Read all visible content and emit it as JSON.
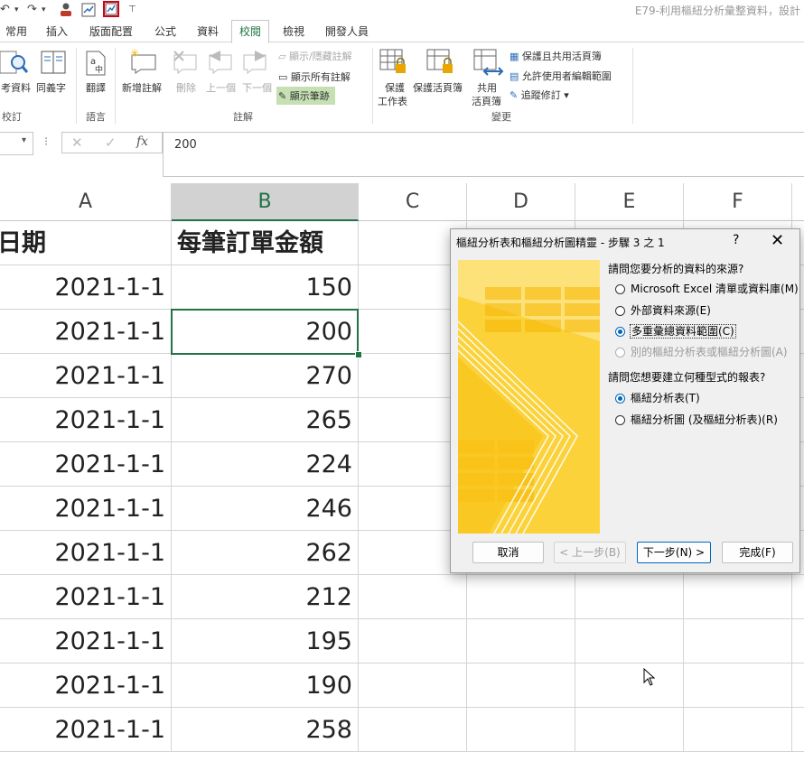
{
  "window": {
    "title": "E79-利用樞紐分析彙整資料，設計"
  },
  "qat": {
    "undo": "↶",
    "redo": "↷",
    "dd1": "▾",
    "dd2": "▾",
    "customize": "⊤"
  },
  "tabs": [
    "常用",
    "插入",
    "版面配置",
    "公式",
    "資料",
    "校閱",
    "檢視",
    "開發人員"
  ],
  "active_tab": "校閱",
  "ribbon": {
    "proofing": {
      "items": [
        "考資料",
        "同義字"
      ],
      "group": "校訂"
    },
    "language": {
      "items": [
        "翻譯"
      ],
      "group": "語言"
    },
    "comments": {
      "new": "新增註解",
      "delete": "刪除",
      "prev": "上一個",
      "next": "下一個",
      "show_hide": "顯示/隱藏註解",
      "show_all": "顯示所有註解",
      "show_ink": "顯示筆跡",
      "group": "註解"
    },
    "changes": {
      "protect_sheet_1": "保護",
      "protect_sheet_2": "工作表",
      "protect_workbook": "保護活頁簿",
      "share_1": "共用",
      "share_2": "活頁簿",
      "protect_share": "保護且共用活頁簿",
      "allow_edit": "允許使用者編輯範圍",
      "track": "追蹤修訂",
      "group": "變更"
    }
  },
  "formula_bar": {
    "namebox_arrow": "▾",
    "dots": "⁝",
    "cancel": "✕",
    "enter": "✓",
    "fx": "fx",
    "value": "200"
  },
  "columns": [
    "A",
    "B",
    "C",
    "D",
    "E",
    "F"
  ],
  "selected_column": "B",
  "sheet": {
    "header": {
      "a": "日期",
      "b": "每筆訂單金額"
    },
    "rows": [
      {
        "a": "2021-1-1",
        "b": "150"
      },
      {
        "a": "2021-1-1",
        "b": "200"
      },
      {
        "a": "2021-1-1",
        "b": "270"
      },
      {
        "a": "2021-1-1",
        "b": "265"
      },
      {
        "a": "2021-1-1",
        "b": "224"
      },
      {
        "a": "2021-1-1",
        "b": "246"
      },
      {
        "a": "2021-1-1",
        "b": "262"
      },
      {
        "a": "2021-1-1",
        "b": "212"
      },
      {
        "a": "2021-1-1",
        "b": "195"
      },
      {
        "a": "2021-1-1",
        "b": "190"
      },
      {
        "a": "2021-1-1",
        "b": "258"
      }
    ]
  },
  "dialog": {
    "title": "樞紐分析表和樞紐分析圖精靈 - 步驟 3 之 1",
    "help": "?",
    "close": "✕",
    "q1": "請問您要分析的資料的來源?",
    "source_options": [
      {
        "label": "Microsoft Excel 清單或資料庫(M)",
        "selected": false,
        "disabled": false
      },
      {
        "label": "外部資料來源(E)",
        "selected": false,
        "disabled": false
      },
      {
        "label": "多重彙總資料範圍(C)",
        "selected": true,
        "disabled": false
      },
      {
        "label": "別的樞紐分析表或樞紐分析圖(A)",
        "selected": false,
        "disabled": true
      }
    ],
    "q2": "請問您想要建立何種型式的報表?",
    "report_options": [
      {
        "label": "樞紐分析表(T)",
        "selected": true
      },
      {
        "label": "樞紐分析圖 (及樞紐分析表)(R)",
        "selected": false
      }
    ],
    "buttons": {
      "cancel": "取消",
      "back": "< 上一步(B)",
      "next": "下一步(N) >",
      "finish": "完成(F)"
    }
  },
  "colors": {
    "accent": "#217346",
    "radio": "#0067c0",
    "wizard_yellow": "#f9c31a"
  }
}
